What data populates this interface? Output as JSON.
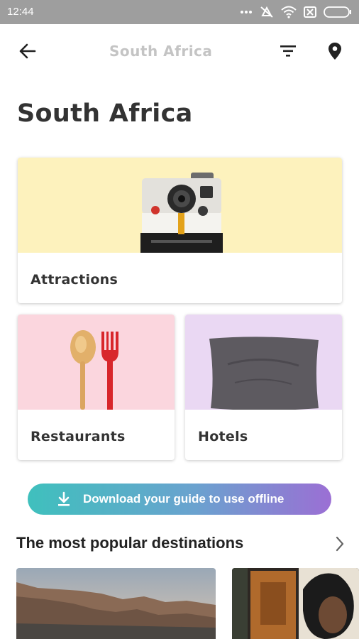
{
  "status_bar": {
    "time": "12:44",
    "icons": [
      "more-icon",
      "alarm-off-icon",
      "wifi-icon",
      "sim-off-icon",
      "battery-icon"
    ]
  },
  "app_bar": {
    "title": "South Africa",
    "back_icon": "arrow-back-icon",
    "filter_icon": "filter-icon",
    "location_icon": "location-pin-icon"
  },
  "page": {
    "title": "South Africa"
  },
  "categories": [
    {
      "label": "Attractions",
      "image": "instant-camera",
      "color": "#fdf2bd"
    },
    {
      "label": "Restaurants",
      "image": "spoon-and-fork",
      "color": "#fbd6de"
    },
    {
      "label": "Hotels",
      "image": "pillow",
      "color": "#ead8f3"
    }
  ],
  "download": {
    "label": "Download your guide to use offline",
    "icon": "download-icon",
    "gradient": [
      "#3fc0bd",
      "#9b6fd4"
    ]
  },
  "popular": {
    "title": "The most popular destinations",
    "chevron_icon": "chevron-right-icon",
    "destinations": [
      {
        "image": "table-mountain-photo"
      },
      {
        "image": "street-art-photo"
      }
    ]
  }
}
